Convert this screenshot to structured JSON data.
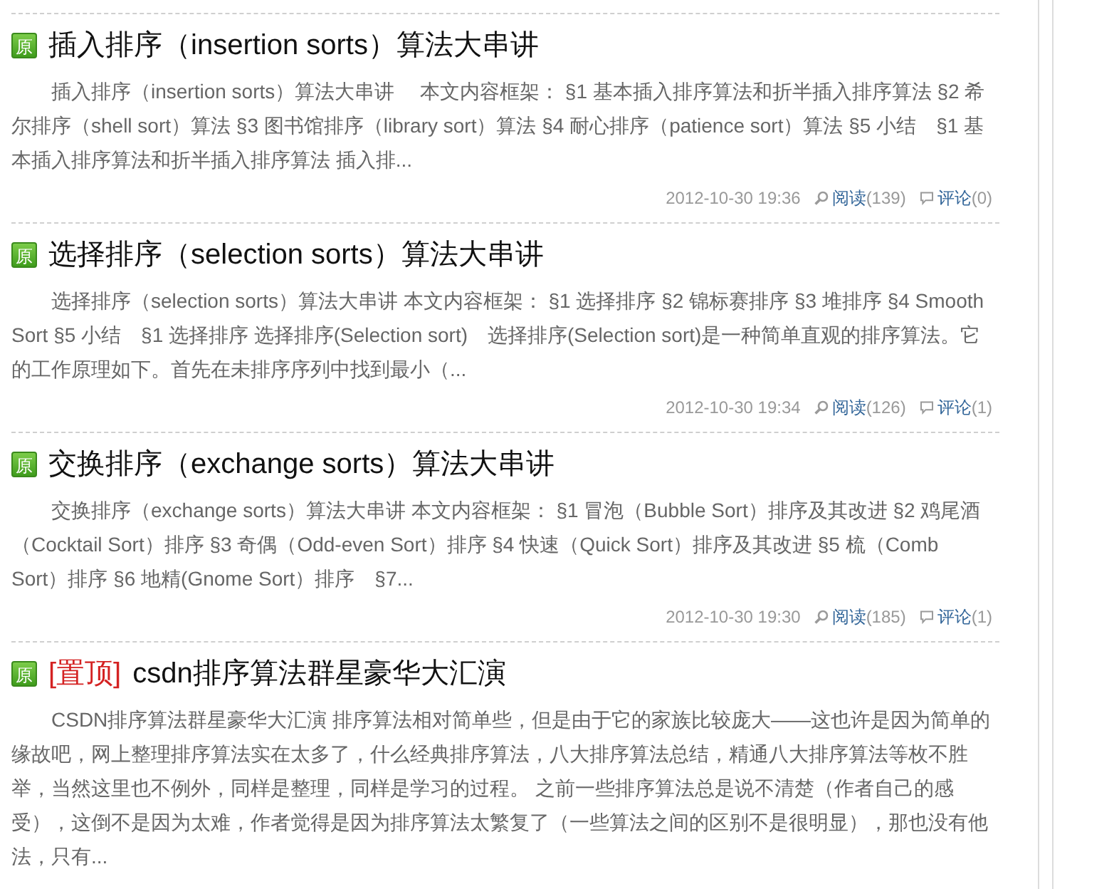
{
  "posts": [
    {
      "badge": "原",
      "title": "插入排序（insertion sorts）算法大串讲",
      "summary": "插入排序（insertion sorts）算法大串讲　 本文内容框架： §1 基本插入排序算法和折半插入排序算法 §2 希尔排序（shell sort）算法 §3 图书馆排序（library sort）算法 §4 耐心排序（patience sort）算法 §5 小结　§1 基本插入排序算法和折半插入排序算法 插入排...",
      "date": "2012-10-30 19:36",
      "read_label": "阅读",
      "read_count": "(139)",
      "comment_label": "评论",
      "comment_count": "(0)"
    },
    {
      "badge": "原",
      "title": "选择排序（selection sorts）算法大串讲",
      "summary": "选择排序（selection sorts）算法大串讲 本文内容框架： §1 选择排序 §2 锦标赛排序 §3 堆排序 §4 Smooth Sort §5 小结　§1 选择排序 选择排序(Selection sort)　选择排序(Selection sort)是一种简单直观的排序算法。它的工作原理如下。首先在未排序序列中找到最小（...",
      "date": "2012-10-30 19:34",
      "read_label": "阅读",
      "read_count": "(126)",
      "comment_label": "评论",
      "comment_count": "(1)"
    },
    {
      "badge": "原",
      "title": "交换排序（exchange sorts）算法大串讲",
      "summary": "交换排序（exchange sorts）算法大串讲 本文内容框架： §1 冒泡（Bubble Sort）排序及其改进 §2 鸡尾酒（Cocktail Sort）排序 §3 奇偶（Odd-even Sort）排序 §4 快速（Quick Sort）排序及其改进 §5 梳（Comb Sort）排序 §6 地精(Gnome Sort）排序　§7...",
      "date": "2012-10-30 19:30",
      "read_label": "阅读",
      "read_count": "(185)",
      "comment_label": "评论",
      "comment_count": "(1)"
    },
    {
      "badge": "原",
      "tag": "[置顶]",
      "title": "csdn排序算法群星豪华大汇演",
      "summary": "CSDN排序算法群星豪华大汇演 排序算法相对简单些，但是由于它的家族比较庞大——这也许是因为简单的缘故吧，网上整理排序算法实在太多了，什么经典排序算法，八大排序算法总结，精通八大排序算法等枚不胜举，当然这里也不例外，同样是整理，同样是学习的过程。 之前一些排序算法总是说不清楚（作者自己的感受），这倒不是因为太难，作者觉得是因为排序算法太繁复了（一些算法之间的区别不是很明显），那也没有他法，只有..."
    }
  ]
}
